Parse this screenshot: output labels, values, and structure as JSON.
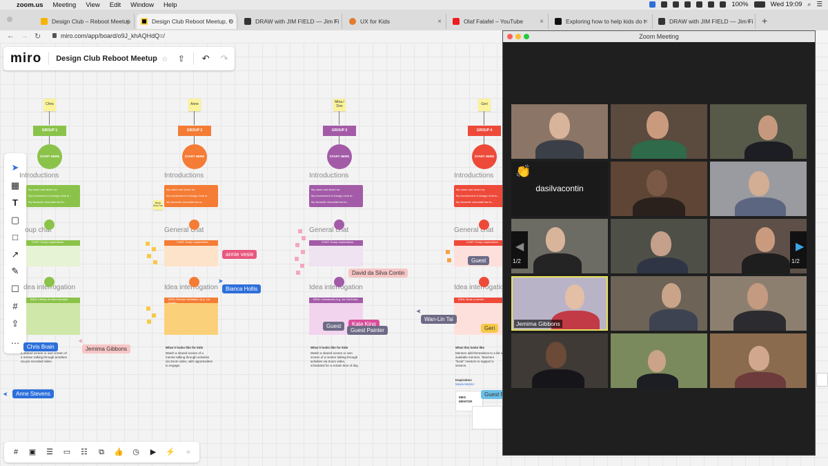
{
  "menubar": {
    "app": "zoom.us",
    "items": [
      "Meeting",
      "View",
      "Edit",
      "Window",
      "Help"
    ],
    "battery": "100%",
    "clock": "Wed 19:09"
  },
  "tabs": [
    {
      "label": "Design Club – Reboot Meetup"
    },
    {
      "label": "Design Club Reboot Meetup, O"
    },
    {
      "label": "DRAW with JIM FIELD — Jim Fi"
    },
    {
      "label": "UX for Kids"
    },
    {
      "label": "Olaf Falafel – YouTube"
    },
    {
      "label": "Exploring how to help kids do t"
    },
    {
      "label": "DRAW with JIM FIELD — Jim Fi"
    }
  ],
  "new_tab": "+",
  "address": {
    "url": "miro.com/app/board/o9J_khAQHdQ=/"
  },
  "miro": {
    "logo": "miro",
    "board_title": "Design Club Reboot Meetup",
    "groups": [
      {
        "owner": "Chris",
        "label": "GROUP 1",
        "start": "START HERE"
      },
      {
        "owner": "Anne",
        "label": "GROUP 2",
        "start": "START HERE"
      },
      {
        "owner": "Mina / Don",
        "label": "GROUP 3",
        "start": "START HERE"
      },
      {
        "owner": "Geri",
        "label": "GROUP 4",
        "start": "START HERE"
      }
    ],
    "sections": {
      "intro": "Introductions",
      "chat": "General chat",
      "idea": "Idea interrogation"
    },
    "section_partials": {
      "chat1": "oup chat",
      "idea1": "dea interrogation"
    },
    "intro_lines": [
      "My name and what I do",
      "My involvement in Design Club is...",
      "My favourite chocolate bar is..."
    ],
    "chat_card": "CHAT: Group explorations",
    "idea_cards": [
      "IDEA: Library of video tutorials",
      "IDEA: Remote facilitation (e.g. via Zoom)",
      "IDEA: Livestream (e.g. via YouTube)",
      "IDEA: Book a mentor"
    ],
    "looks_like_title": "What it looks like for kids",
    "looks_like": [
      "a shared screen or own screen of a mentor talking through activities via pre recorded video.",
      "Watch a shared screen of a mentor talking through activities via Zoom video, with opportunities to engage.",
      "Watch a shared screen or own screen of a mentor talking through activities via Zoom video, scheduled for a certain time of day.",
      "Mentors add themselves to a list of available mentors. Teachers \"book\" mentors to support a session."
    ],
    "looks_like_title4": "What this looks like",
    "inspiration": {
      "label": "Inspiration:",
      "link": "Meyla Mentor",
      "logo": "MEG MENTOR"
    },
    "small_sticky": "Book Kick-The",
    "cursors": [
      {
        "name": "annie vesie",
        "color": "#e8577d"
      },
      {
        "name": "Bianca Hollis",
        "color": "#2d6fdb"
      },
      {
        "name": "David da Silva Contin",
        "color": "#f7c5c5",
        "text_color": "#333"
      },
      {
        "name": "Wan-Lin Tai",
        "color": "#6d6a86"
      },
      {
        "name": "Kate King",
        "color": "#d94e9a"
      },
      {
        "name": "Guest Painter",
        "color": "#6d6a86"
      },
      {
        "name": "Guest",
        "color": "#6d6a86"
      },
      {
        "name": "Geri",
        "color": "#f7c948",
        "text_color": "#333"
      },
      {
        "name": "Chris Brain",
        "color": "#2d6fdb"
      },
      {
        "name": "Jemima Gibbons",
        "color": "#f7c5c5",
        "text_color": "#333"
      },
      {
        "name": "Anne Stevens",
        "color": "#2d6fdb"
      },
      {
        "name": "Guest P",
        "color": "#6cc0e8",
        "text_color": "#333"
      },
      {
        "name": "Guest",
        "color": "#6d6a86"
      }
    ]
  },
  "zoom": {
    "title": "Zoom Meeting",
    "reaction": "👏",
    "no_video_name": "dasilvacontin",
    "active_speaker": "Jemima Gibbons",
    "page_left": "1/2",
    "page_right": "1/2",
    "accent": "#e7e35a"
  }
}
